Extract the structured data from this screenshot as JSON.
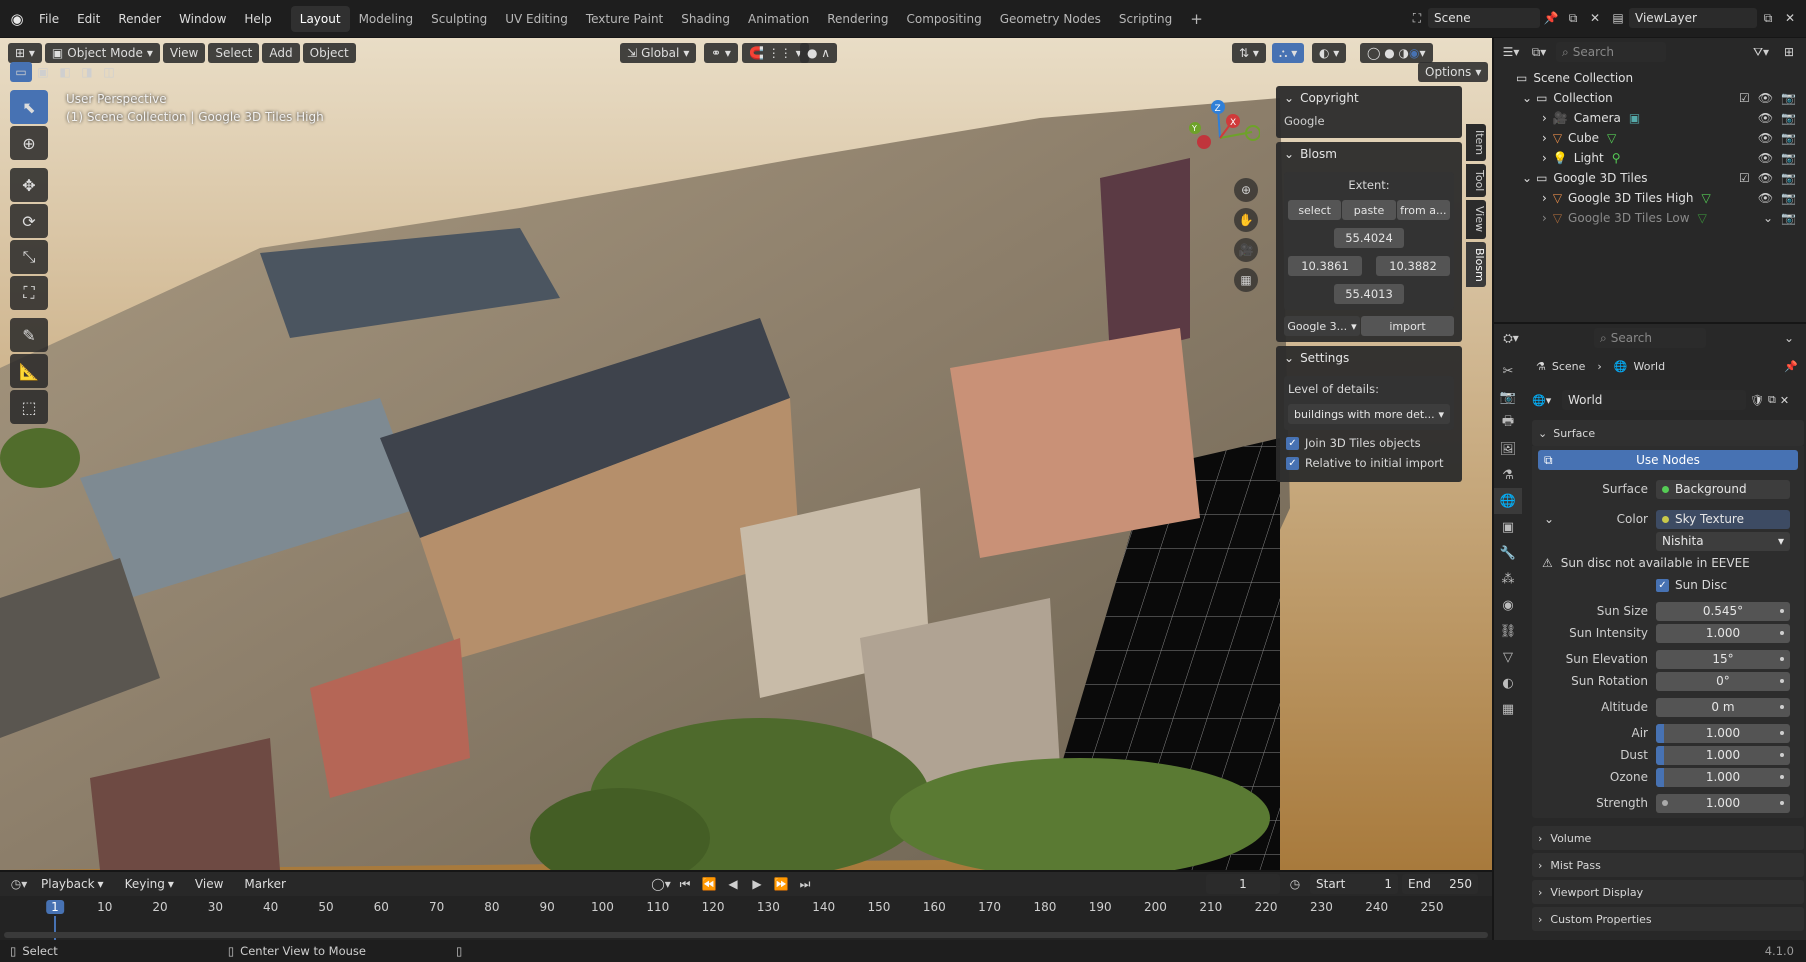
{
  "topbar": {
    "menus": [
      "File",
      "Edit",
      "Render",
      "Window",
      "Help"
    ],
    "workspaces": [
      "Layout",
      "Modeling",
      "Sculpting",
      "UV Editing",
      "Texture Paint",
      "Shading",
      "Animation",
      "Rendering",
      "Compositing",
      "Geometry Nodes",
      "Scripting"
    ],
    "active_workspace": "Layout",
    "add_workspace": "+",
    "scene": "Scene",
    "view_layer": "ViewLayer"
  },
  "viewport": {
    "mode": "Object Mode",
    "menus": [
      "View",
      "Select",
      "Add",
      "Object"
    ],
    "orientation": "Global",
    "options": "Options",
    "overlay_line1": "User Perspective",
    "overlay_line2": "(1) Scene Collection | Google 3D Tiles High",
    "side_tabs": [
      "Item",
      "Tool",
      "View",
      "Blosm"
    ],
    "active_side_tab": "Blosm"
  },
  "npanel": {
    "copyright": {
      "title": "Copyright",
      "text": "Google"
    },
    "blosm": {
      "title": "Blosm",
      "extent_label": "Extent:",
      "select": "select",
      "paste": "paste",
      "from": "from a...",
      "top": "55.4024",
      "left": "10.3861",
      "right": "10.3882",
      "bottom": "55.4013",
      "source": "Google 3...",
      "import": "import"
    },
    "settings": {
      "title": "Settings",
      "lod_label": "Level of details:",
      "lod_value": "buildings with more det...",
      "join": "Join 3D Tiles objects",
      "relative": "Relative to initial import"
    }
  },
  "outliner": {
    "search_placeholder": "Search",
    "items": [
      {
        "label": "Scene Collection"
      },
      {
        "label": "Collection"
      },
      {
        "label": "Camera"
      },
      {
        "label": "Cube"
      },
      {
        "label": "Light"
      },
      {
        "label": "Google 3D Tiles"
      },
      {
        "label": "Google 3D Tiles High"
      },
      {
        "label": "Google 3D Tiles Low"
      }
    ]
  },
  "properties": {
    "search_placeholder": "Search",
    "breadcrumb_scene": "Scene",
    "breadcrumb_world": "World",
    "world_name": "World",
    "surface_panel": "Surface",
    "use_nodes": "Use Nodes",
    "surface_label": "Surface",
    "surface_value": "Background",
    "color_label": "Color",
    "color_value": "Sky Texture",
    "sky_type": "Nishita",
    "warning": "Sun disc not available in EEVEE",
    "sun_disc": "Sun Disc",
    "rows": [
      {
        "label": "Sun Size",
        "value": "0.545°"
      },
      {
        "label": "Sun Intensity",
        "value": "1.000"
      },
      {
        "label": "Sun Elevation",
        "value": "15°"
      },
      {
        "label": "Sun Rotation",
        "value": "0°"
      },
      {
        "label": "Altitude",
        "value": "0 m"
      },
      {
        "label": "Air",
        "value": "1.000"
      },
      {
        "label": "Dust",
        "value": "1.000"
      },
      {
        "label": "Ozone",
        "value": "1.000"
      },
      {
        "label": "Strength",
        "value": "1.000"
      }
    ],
    "panels": [
      "Volume",
      "Mist Pass",
      "Viewport Display",
      "Custom Properties"
    ]
  },
  "timeline": {
    "menus": [
      "Playback",
      "Keying",
      "View",
      "Marker"
    ],
    "current_frame": "1",
    "start_label": "Start",
    "start": "1",
    "end_label": "End",
    "end": "250",
    "ruler": [
      "1",
      "10",
      "20",
      "30",
      "40",
      "50",
      "60",
      "70",
      "80",
      "90",
      "100",
      "110",
      "120",
      "130",
      "140",
      "150",
      "160",
      "170",
      "180",
      "190",
      "200",
      "210",
      "220",
      "230",
      "240",
      "250"
    ]
  },
  "statusbar": {
    "select": "Select",
    "center": "Center View to Mouse",
    "version": "4.1.0"
  },
  "colors": {
    "accent": "#4772b3",
    "world_icon": "#e07a4a"
  }
}
